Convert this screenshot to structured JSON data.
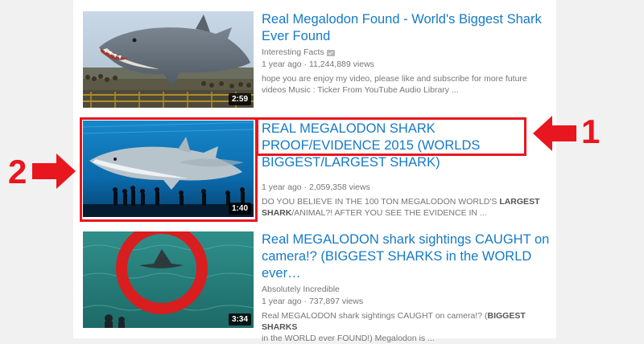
{
  "results": [
    {
      "title": "Real Megalodon Found - World's Biggest Shark Ever Found",
      "channel": "Interesting Facts",
      "verified_icon": "verified-badge-icon",
      "age": "1 year ago",
      "views": "11,244,889 views",
      "description_lines": [
        {
          "parts": [
            {
              "text": "hope you are enjoy my video, please like and subscribe for more future",
              "bold": false
            }
          ]
        },
        {
          "parts": [
            {
              "text": "videos Music : Ticker From YouTube Audio Library ...",
              "bold": false
            }
          ]
        }
      ],
      "duration": "2:59"
    },
    {
      "title": "REAL MEGALODON SHARK PROOF/EVIDENCE 2015 (WORLDS BIGGEST/LARGEST SHARK)",
      "channel": "",
      "age": "1 year ago",
      "views": "2,059,358 views",
      "description_lines": [
        {
          "parts": [
            {
              "text": "DO YOU BELIEVE IN THE 100 TON MEGALODON WORLD'S ",
              "bold": false
            },
            {
              "text": "LARGEST",
              "bold": true
            }
          ]
        },
        {
          "parts": [
            {
              "text": "SHARK",
              "bold": true
            },
            {
              "text": "/ANIMAL?! AFTER YOU SEE THE EVIDENCE IN ...",
              "bold": false
            }
          ]
        }
      ],
      "duration": "1:40"
    },
    {
      "title": "Real MEGALODON shark sightings CAUGHT on camera!? (BIGGEST SHARKS in the WORLD ever…",
      "channel": "Absolutely Incredible",
      "age": "1 year ago",
      "views": "737,897 views",
      "description_lines": [
        {
          "parts": [
            {
              "text": "Real MEGALODON shark sightings CAUGHT on camera!? (",
              "bold": false
            },
            {
              "text": "BIGGEST SHARKS",
              "bold": true
            }
          ]
        },
        {
          "parts": [
            {
              "text": "in the WORLD ever FOUND!) Megalodon is ...",
              "bold": false
            }
          ]
        }
      ],
      "duration": "3:34"
    }
  ],
  "annotations": {
    "label_1": "1",
    "label_2": "2",
    "color": "#e8161f"
  },
  "colors": {
    "title_link": "#167ac6",
    "meta_text": "#767676",
    "background": "#f1f1f1"
  }
}
